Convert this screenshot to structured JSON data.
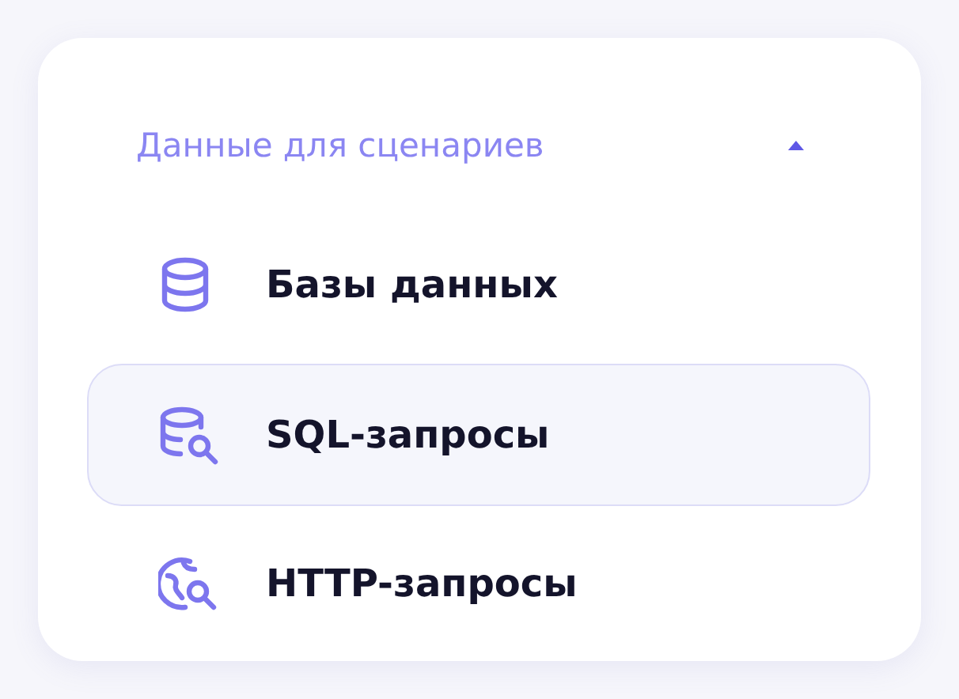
{
  "section": {
    "title": "Данные для сценариев",
    "expanded": true,
    "items": [
      {
        "label": "Базы данных",
        "kind": "database",
        "selected": false
      },
      {
        "label": "SQL-запросы",
        "kind": "query",
        "selected": true
      },
      {
        "label": "HTTP-запросы",
        "kind": "web",
        "selected": false
      }
    ]
  }
}
